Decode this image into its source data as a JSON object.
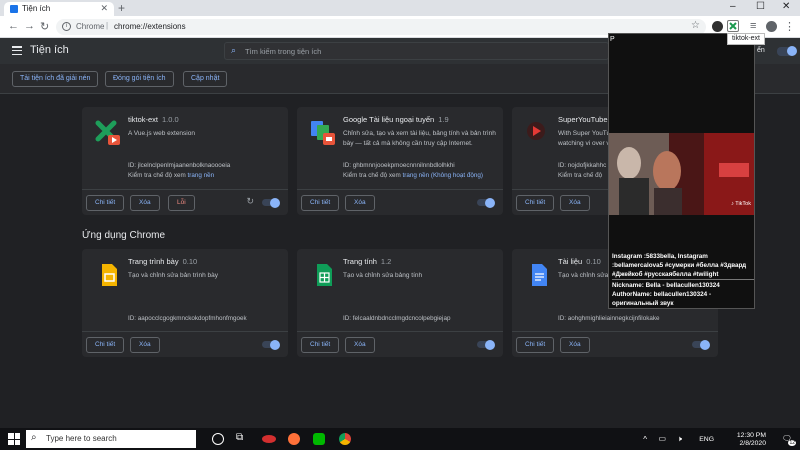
{
  "browser": {
    "tab_title": "Tiện ích",
    "tab_close": "✕",
    "new_tab": "+",
    "window_controls": [
      "–",
      "☐",
      "✕"
    ],
    "url_origin": "Chrome",
    "url_separator": "|",
    "url_path": "chrome://extensions",
    "tooltip": "tiktok-ext"
  },
  "header": {
    "title": "Tiện ích",
    "search_placeholder": "Tìm kiếm trong tiện ích",
    "devmode_label": "ển"
  },
  "actions": {
    "load_unpacked": "Tải tiện ích đã giải nén",
    "pack": "Đóng gói tiện ích",
    "update": "Cập nhật"
  },
  "extensions": [
    {
      "name": "tiktok-ext",
      "version": "1.0.0",
      "description": "A Vue.js web extension",
      "id": "ID: jlcelnclpenlmjaanenbolknaoooeia",
      "inspect_prefix": "Kiểm tra chế độ xem ",
      "inspect_link": "trang nền",
      "details": "Chi tiết",
      "remove": "Xóa",
      "errors": "Lỗi"
    },
    {
      "name": "Google Tài liệu ngoại tuyến",
      "version": "1.9",
      "description": "Chỉnh sửa, tạo và xem tài liệu, bảng tính và bản trình bày — tất cả mà không cần truy cập Internet.",
      "id": "ID: ghbmnnjooekpmoecnnnilnnbdlolhkhi",
      "inspect_prefix": "Kiểm tra chế độ xem ",
      "inspect_link": "trang nền (Không hoạt động)",
      "details": "Chi tiết",
      "remove": "Xóa"
    },
    {
      "name": "SuperYouTube (E",
      "version": "",
      "description": "With Super YouTu while watching vi over video.",
      "id": "ID: nojdofjkkahhc",
      "inspect_prefix": "Kiểm tra chế độ",
      "inspect_link": "",
      "details": "Chi tiết",
      "remove": "Xóa"
    }
  ],
  "apps_section_title": "Ứng dụng Chrome",
  "apps": [
    {
      "name": "Trang trình bày",
      "version": "0.10",
      "description": "Tạo và chỉnh sửa bản trình bày",
      "id": "ID: aapocclcgogkmnckokdopfmhonfmgoek",
      "details": "Chi tiết",
      "remove": "Xóa"
    },
    {
      "name": "Trang tính",
      "version": "1.2",
      "description": "Tạo và chỉnh sửa bảng tính",
      "id": "ID: felcaaldnbdncclmgdcncolpebgiejap",
      "details": "Chi tiết",
      "remove": "Xóa"
    },
    {
      "name": "Tài liệu",
      "version": "0.10",
      "description": "Tạo và chỉnh sửa tài liệu",
      "id": "ID: aohghmighlieiainnegkcijnfilokake",
      "details": "Chi tiết",
      "remove": "Xóa"
    }
  ],
  "popup": {
    "cursor_text": "P",
    "caption": "Instagram :5833bella, Instagram :bellamercalova5 #сумерки #белла #3двард #Джейкоб #русскаябелла #twilight",
    "author": "Nickname: Bella - bellacullen130324 AuthorName: bellacullen130324 - оригинальный звук",
    "watermark": "♪ TikTok"
  },
  "taskbar": {
    "search_placeholder": "Type here to search",
    "language": "ENG",
    "time": "12:30 PM",
    "date": "2/8/2020",
    "badge": "12"
  },
  "colors": {
    "accent": "#8ab4f8",
    "error": "#f28b82",
    "card_bg": "#292a2d",
    "page_bg": "#202124"
  }
}
